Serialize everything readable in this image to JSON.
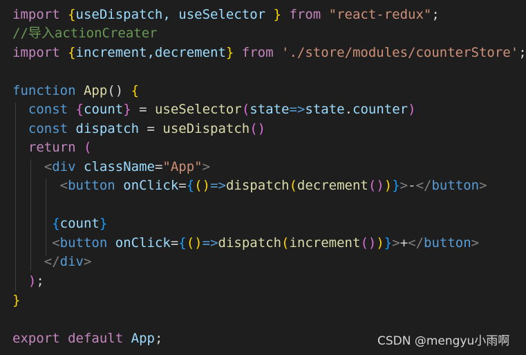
{
  "code": {
    "l1": {
      "import": "import",
      "open": "{",
      "names": "useDispatch, useSelector ",
      "close": "}",
      "from": "from",
      "module": "\"react-redux\"",
      "semicolon": ";"
    },
    "l2": {
      "comment": "//导入actionCreater"
    },
    "l3": {
      "import": "import",
      "open": "{",
      "names": "increment,decrement",
      "close": "}",
      "from": "from",
      "module": "'./store/modules/counterStore'",
      "semicolon": ";"
    },
    "l4": {
      "function": "function",
      "name": "App",
      "parens": "()",
      "brace": "{"
    },
    "l5": {
      "const": "const",
      "open": "{",
      "count": "count",
      "close": "}",
      "eq": " = ",
      "fn": "useSelector",
      "pOpen": "(",
      "param": "state",
      "arrow": "=>",
      "state": "state",
      "dot": ".",
      "prop": "counter",
      "pClose": ")"
    },
    "l6": {
      "const": "const",
      "name": "dispatch",
      "eq": " = ",
      "fn": "useDispatch",
      "parens": "()"
    },
    "l7": {
      "return": "return",
      "paren": "("
    },
    "l8": {
      "lt": "<",
      "tag": "div",
      "attr": "className",
      "eq": "=",
      "value": "\"App\"",
      "gt": ">"
    },
    "l9": {
      "lt": "<",
      "tag": "button",
      "attr": "onClick",
      "eq": "=",
      "braceOpen": "{",
      "parens": "()",
      "arrow": "=>",
      "fn": "dispatch",
      "pOpen": "(",
      "inner": "decrement",
      "innerParens": "()",
      "pClose": ")",
      "braceClose": "}",
      "gt": ">",
      "text": "-",
      "closeLt": "</",
      "closeTag": "button",
      "closeGt": ">"
    },
    "l11": {
      "open": "{",
      "count": "count",
      "close": "}"
    },
    "l12": {
      "lt": "<",
      "tag": "button",
      "attr": "onClick",
      "eq": "=",
      "braceOpen": "{",
      "parens": "()",
      "arrow": "=>",
      "fn": "dispatch",
      "pOpen": "(",
      "inner": "increment",
      "innerParens": "()",
      "pClose": ")",
      "braceClose": "}",
      "gt": ">",
      "text": "+",
      "closeLt": "</",
      "closeTag": "button",
      "closeGt": ">"
    },
    "l13": {
      "closeLt": "</",
      "closeTag": "div",
      "closeGt": ">"
    },
    "l14": {
      "paren": ")",
      "semicolon": ";"
    },
    "l15": {
      "brace": "}"
    },
    "l17": {
      "export": "export",
      "default": "default",
      "name": "App",
      "semicolon": ";"
    }
  },
  "watermark": {
    "text": "CSDN @mengyu小雨啊"
  },
  "colors": {
    "background": "#1e1e1e",
    "keyword": "#569cd6",
    "control_keyword": "#c586c0",
    "function": "#dcdcaa",
    "variable": "#9cdcfe",
    "string": "#ce9178",
    "comment": "#6a9955",
    "bracket_gold": "#ffd700",
    "bracket_pink": "#da70d6",
    "bracket_blue": "#179fff"
  }
}
